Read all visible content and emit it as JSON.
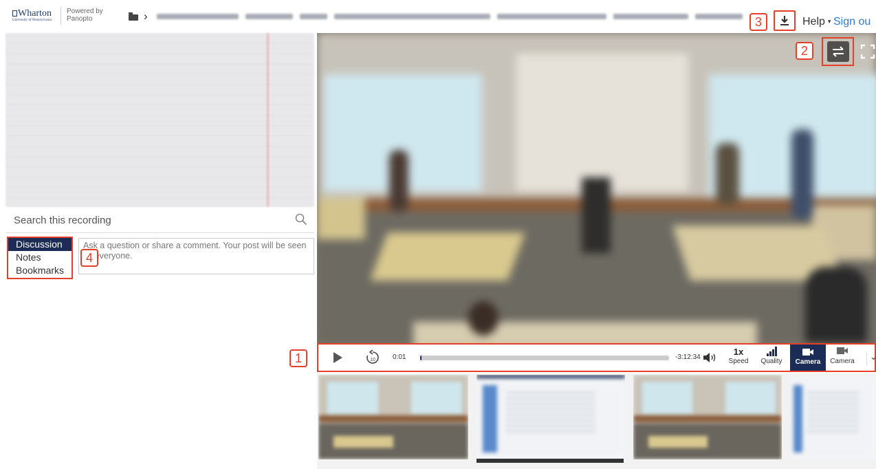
{
  "header": {
    "logo_text": "Wharton",
    "logo_subtext": "University of Pennsylvania",
    "powered_by": "Powered by",
    "powered_brand": "Panopto",
    "help_label": "Help",
    "help_caret": "▾",
    "signout_label": "Sign ou",
    "chevron": "›"
  },
  "search": {
    "placeholder": "Search this recording"
  },
  "tabs": [
    "Discussion",
    "Notes",
    "Bookmarks"
  ],
  "comment": {
    "placeholder": "Ask a question or share a comment. Your post will be seen by everyone."
  },
  "player": {
    "current_time": "0:01",
    "remaining_time": "-3:12:34",
    "progress_fraction": 0.0,
    "speed_value": "1x",
    "speed_label": "Speed",
    "quality_label": "Quality",
    "camera_active_label": "Camera",
    "camera_label": "Camera",
    "more": "⌄"
  },
  "badges": [
    "1",
    "2",
    "3",
    "4"
  ],
  "colors": {
    "accent_navy": "#1b2d56",
    "highlight_red": "#e53f27",
    "link_blue": "#2e7bd6"
  },
  "icons": [
    "folder-icon",
    "download-icon",
    "search-icon",
    "swap-view-icon",
    "fullscreen-icon",
    "play-icon",
    "rewind-10-icon",
    "volume-icon",
    "quality-bars-icon",
    "camera-icon",
    "chevron-down-icon"
  ]
}
